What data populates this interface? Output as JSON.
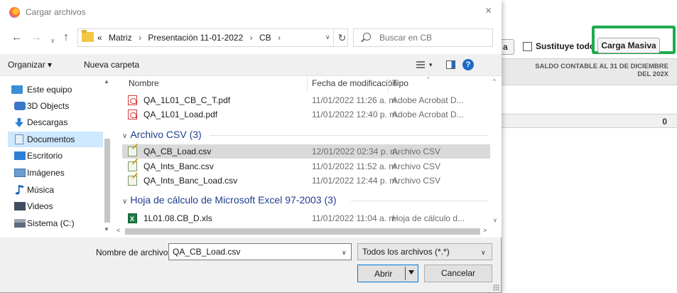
{
  "dialog": {
    "title": "Cargar archivos",
    "close_glyph": "×",
    "breadcrumb": {
      "lead": "«",
      "parts": [
        "Matriz",
        "Presentación 11-01-2022",
        "CB"
      ]
    },
    "search_placeholder": "Buscar en CB",
    "toolbar": {
      "organize_label": "Organizar ▾",
      "new_folder_label": "Nueva carpeta",
      "help_glyph": "?"
    },
    "nav_items": [
      {
        "label": "Este equipo",
        "icon": "computer-icon"
      },
      {
        "label": "3D Objects",
        "icon": "3d-objects-icon"
      },
      {
        "label": "Descargas",
        "icon": "download-icon"
      },
      {
        "label": "Documentos",
        "icon": "documents-icon",
        "selected": true
      },
      {
        "label": "Escritorio",
        "icon": "desktop-icon"
      },
      {
        "label": "Imágenes",
        "icon": "pictures-icon"
      },
      {
        "label": "Música",
        "icon": "music-icon"
      },
      {
        "label": "Videos",
        "icon": "videos-icon"
      },
      {
        "label": "Sistema (C:)",
        "icon": "drive-icon"
      }
    ],
    "columns": {
      "name": "Nombre",
      "date": "Fecha de modificación",
      "type": "Tipo"
    },
    "files_top": [
      {
        "name": "QA_1L01_CB_C_T.pdf",
        "date": "11/01/2022 11:26 a. m.",
        "type": "Adobe Acrobat D...",
        "icon": "pdf-icon"
      },
      {
        "name": "QA_1L01_Load.pdf",
        "date": "11/01/2022 12:40 p. m.",
        "type": "Adobe Acrobat D...",
        "icon": "pdf-icon"
      }
    ],
    "group_csv": {
      "label": "Archivo CSV (3)",
      "files": [
        {
          "name": "QA_CB_Load.csv",
          "date": "12/01/2022 02:34 p. m.",
          "type": "Archivo CSV",
          "icon": "csv-icon",
          "selected": true
        },
        {
          "name": "QA_Ints_Banc.csv",
          "date": "11/01/2022 11:52 a. m.",
          "type": "Archivo CSV",
          "icon": "csv-icon"
        },
        {
          "name": "QA_Ints_Banc_Load.csv",
          "date": "11/01/2022 12:44 p. m.",
          "type": "Archivo CSV",
          "icon": "csv-icon"
        }
      ]
    },
    "group_xls": {
      "label": "Hoja de cálculo de Microsoft Excel 97-2003 (3)",
      "files": [
        {
          "name": "1L01.08.CB_D.xls",
          "date": "11/01/2022 11:04 a. m.",
          "type": "Hoja de cálculo d...",
          "icon": "xls-icon"
        }
      ]
    },
    "filename_label": "Nombre de archivo:",
    "filename_value": "QA_CB_Load.csv",
    "filter_value": "Todos los archivos (*.*)",
    "open_label": "Abrir",
    "cancel_label": "Cancelar"
  },
  "background": {
    "button_fragment": "a",
    "replace_all_label": "Sustituye todo",
    "bulk_load_label": "Carga Masiva",
    "column_header": "SALDO CONTABLE AL 31 DE DICIEMBRE DEL 202X",
    "cell_value": "0",
    "highlight_color": "#1faa4d"
  }
}
